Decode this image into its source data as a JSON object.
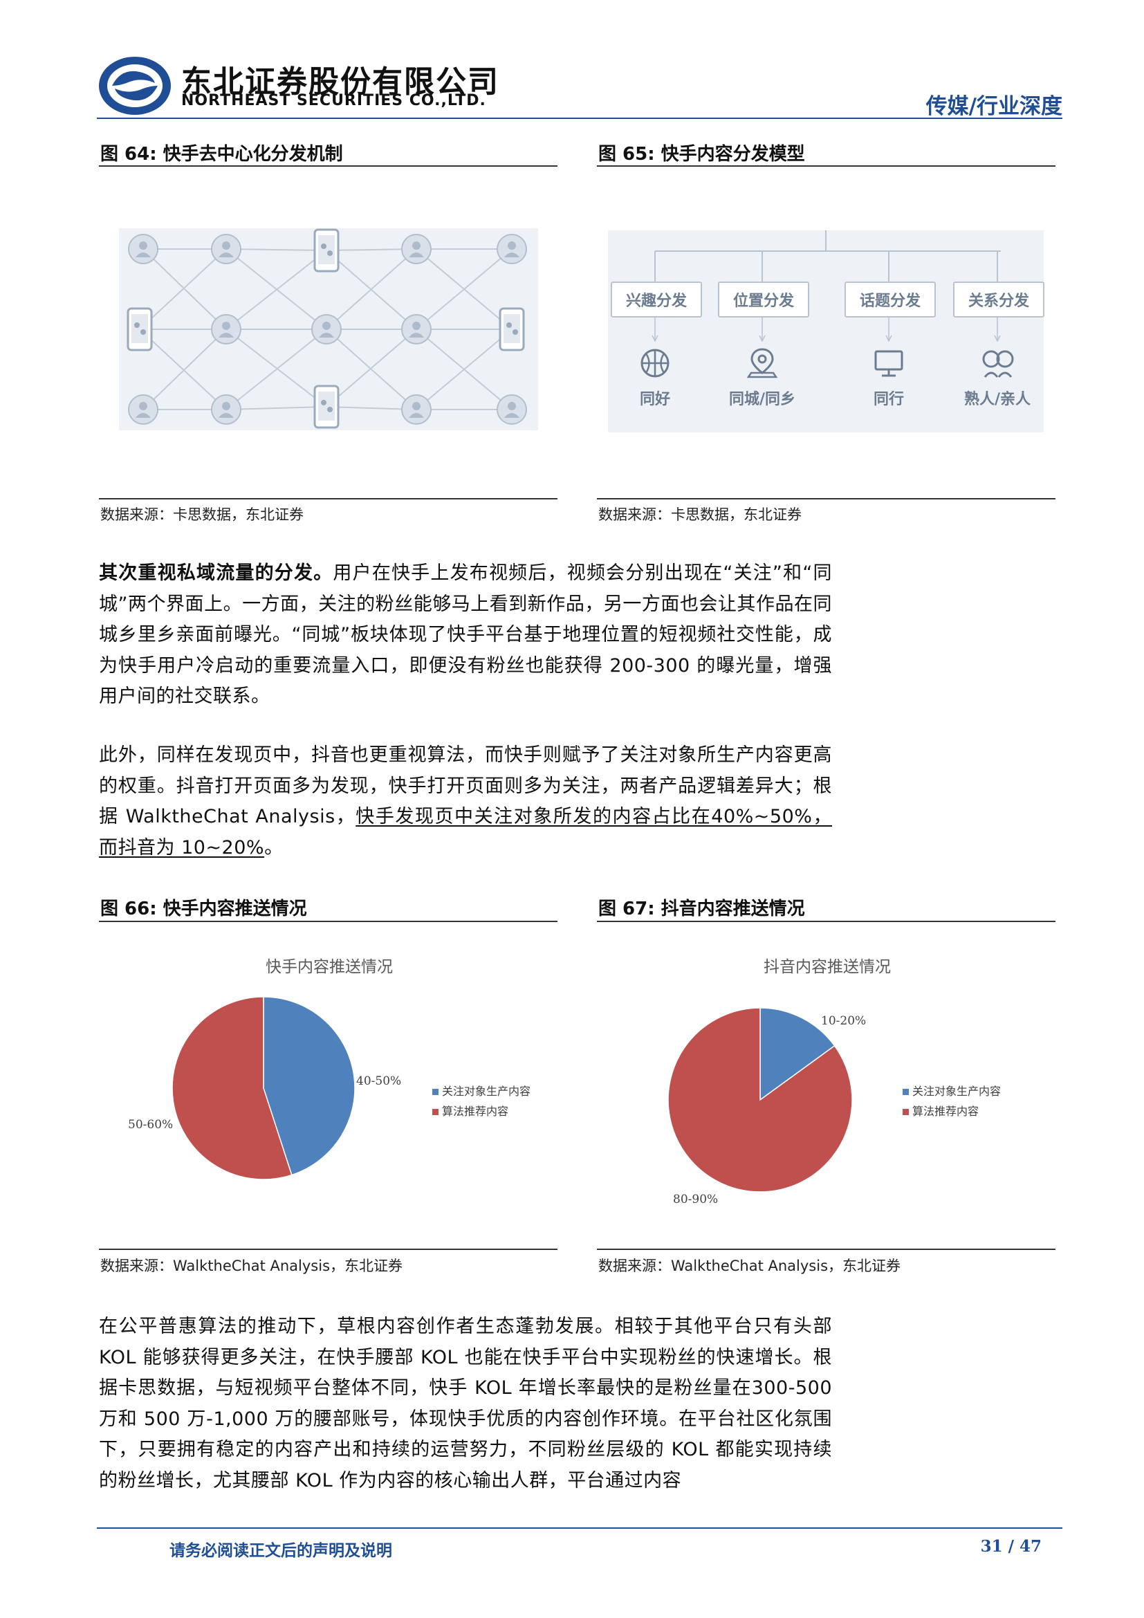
{
  "header": {
    "company_cn": "东北证券股份有限公司",
    "company_en": "NORTHEAST SECURITIES CO.,LTD.",
    "category": "传媒/行业深度",
    "brand_color": "#1f4e96"
  },
  "fig64": {
    "title": "图 64: 快手去中心化分发机制",
    "source": "数据来源：卡思数据，东北证券"
  },
  "fig65": {
    "title": "图 65: 快手内容分发模型",
    "source": "数据来源：卡思数据，东北证券",
    "columns": [
      {
        "box": "兴趣分发",
        "label": "同好",
        "icon": "basketball-icon"
      },
      {
        "box": "位置分发",
        "label": "同城/同乡",
        "icon": "location-pin-icon"
      },
      {
        "box": "话题分发",
        "label": "同行",
        "icon": "monitor-icon"
      },
      {
        "box": "关系分发",
        "label": "熟人/亲人",
        "icon": "people-icon"
      }
    ]
  },
  "para1": {
    "lead": "其次重视私域流量的分发。",
    "body": "用户在快手上发布视频后，视频会分别出现在“关注”和“同城”两个界面上。一方面，关注的粉丝能够马上看到新作品，另一方面也会让其作品在同城乡里乡亲面前曝光。“同城”板块体现了快手平台基于地理位置的短视频社交性能，成为快手用户冷启动的重要流量入口，即便没有粉丝也能获得 200-300 的曝光量，增强用户间的社交联系。"
  },
  "para2": {
    "body": "此外，同样在发现页中，抖音也更重视算法，而快手则赋予了关注对象所生产内容更高的权重。抖音打开页面多为发现，快手打开页面则多为关注，两者产品逻辑差异大；根据 WalktheChat Analysis，",
    "underlined": "快手发现页中关注对象所发的内容占比在40%~50%，而抖音为 10~20%",
    "tail": "。"
  },
  "fig66": {
    "title": "图 66: 快手内容推送情况",
    "source": "数据来源：WalktheChat Analysis，东北证券"
  },
  "fig67": {
    "title": "图 67: 抖音内容推送情况",
    "source": "数据来源：WalktheChat Analysis，东北证券"
  },
  "chart_data": [
    {
      "type": "pie",
      "title": "快手内容推送情况",
      "categories": [
        "关注对象生产内容",
        "算法推荐内容"
      ],
      "values": [
        45,
        55
      ],
      "data_labels": [
        "40-50%",
        "50-60%"
      ],
      "colors": [
        "#4f81bd",
        "#c0504d"
      ],
      "legend": "right"
    },
    {
      "type": "pie",
      "title": "抖音内容推送情况",
      "categories": [
        "关注对象生产内容",
        "算法推荐内容"
      ],
      "values": [
        15,
        85
      ],
      "data_labels": [
        "10-20%",
        "80-90%"
      ],
      "colors": [
        "#4f81bd",
        "#c0504d"
      ],
      "legend": "right"
    }
  ],
  "para3": {
    "body": "在公平普惠算法的推动下，草根内容创作者生态蓬勃发展。相较于其他平台只有头部 KOL 能够获得更多关注，在快手腰部 KOL 也能在快手平台中实现粉丝的快速增长。根据卡思数据，与短视频平台整体不同，快手 KOL 年增长率最快的是粉丝量在300-500 万和 500 万-1,000 万的腰部账号，体现快手优质的内容创作环境。在平台社区化氛围下，只要拥有稳定的内容产出和持续的运营努力，不同粉丝层级的 KOL 都能实现持续的粉丝增长，尤其腰部 KOL 作为内容的核心输出人群，平台通过内容"
  },
  "footer": {
    "note": "请务必阅读正文后的声明及说明",
    "page": "31 / 47"
  }
}
